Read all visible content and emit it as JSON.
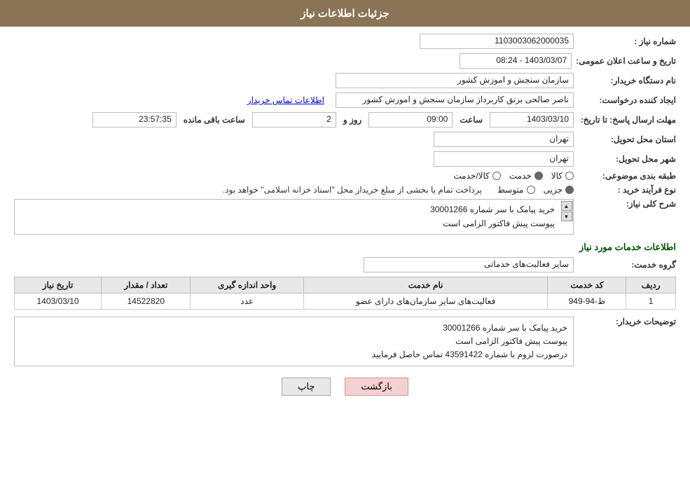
{
  "header": {
    "title": "جزئیات اطلاعات نیاز"
  },
  "fields": {
    "need_number_label": "شماره نیاز :",
    "need_number_value": "1103003062000035",
    "buyer_org_label": "نام دستگاه خریدار:",
    "buyer_org_value": "سازمان سنجش و اموزش کشور",
    "creator_label": "ایجاد کننده درخواست:",
    "creator_value": "ناصر صالحی برنق کاربرداز سازمان سنجش و اموزش کشور",
    "contact_link": "اطلاعات تماس خریدار",
    "deadline_label": "مهلت ارسال پاسخ: تا تاریخ:",
    "deadline_date": "1403/03/10",
    "deadline_time_label": "ساعت",
    "deadline_time": "09:00",
    "deadline_day_label": "روز و",
    "deadline_days": "2",
    "deadline_remaining_label": "ساعت باقی مانده",
    "deadline_remaining": "23:57:35",
    "announce_label": "تاریخ و ساعت اعلان عمومی:",
    "announce_value": "1403/03/07 - 08:24",
    "province_label": "استان محل تحویل:",
    "province_value": "تهران",
    "city_label": "شهر محل تحویل:",
    "city_value": "تهران",
    "category_label": "طبقه بندی موضوعی:",
    "category_options": [
      "کالا",
      "خدمت",
      "کالا/خدمت"
    ],
    "category_selected": "خدمت",
    "process_label": "نوع فرآیند خرید :",
    "process_options": [
      "جزیی",
      "متوسط"
    ],
    "process_selected": "جزیی",
    "process_note": "پرداخت تمام یا بخشی از مبلغ خریداز محل \"اسناد خزانه اسلامی\" خواهد بود.",
    "need_desc_label": "شرح کلی نیاز:",
    "need_desc_line1": "خرید پیامک با سر شماره 30001266",
    "need_desc_line2": "پیوست پیش فاکتور الزامی است",
    "services_title": "اطلاعات خدمات مورد نیاز",
    "service_group_label": "گروه خدمت:",
    "service_group_value": "سایر فعالیت‌های خدماتی",
    "table": {
      "columns": [
        "ردیف",
        "کد خدمت",
        "نام خدمت",
        "واحد اندازه گیری",
        "تعداد / مقدار",
        "تاریخ نیاز"
      ],
      "rows": [
        {
          "row": "1",
          "code": "ظ-94-949",
          "name": "فعالیت‌های سایر سازمان‌های دارای عضو",
          "unit": "عدد",
          "quantity": "14522820",
          "date": "1403/03/10"
        }
      ]
    },
    "buyer_desc_label": "توضیحات خریدار:",
    "buyer_desc_line1": "خرید پیامک با سر شماره 30001266",
    "buyer_desc_line2": "پیوست پیش فاکتور الزامی است",
    "buyer_desc_line3": "درصورت لزوم با شماره 43591422 تماس حاصل فرمایید"
  },
  "buttons": {
    "print": "چاپ",
    "back": "بازگشت"
  }
}
